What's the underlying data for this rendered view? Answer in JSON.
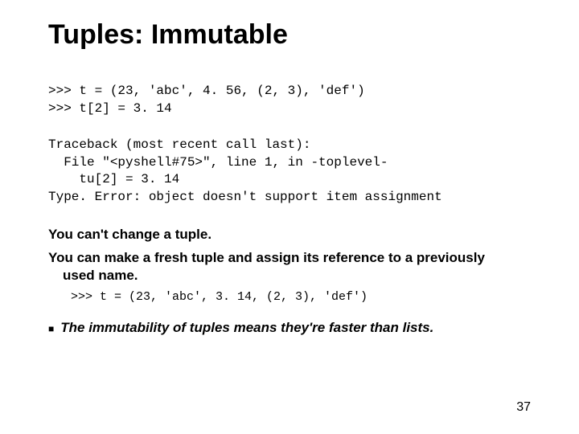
{
  "title": "Tuples: Immutable",
  "code1": ">>> t = (23, 'abc', 4. 56, (2, 3), 'def')\n>>> t[2] = 3. 14",
  "traceback": "Traceback (most recent call last):\n  File \"<pyshell#75>\", line 1, in -toplevel-\n    tu[2] = 3. 14\nType. Error: object doesn't support item assignment",
  "line1": "You can't change a tuple.",
  "line2a": "You can make a fresh tuple and assign its reference to a previously",
  "line2b": "used name.",
  "code2": ">>> t = (23, 'abc', 3. 14, (2, 3), 'def')",
  "bullet": "The immutability of tuples means they're faster than lists.",
  "pageNumber": "37"
}
